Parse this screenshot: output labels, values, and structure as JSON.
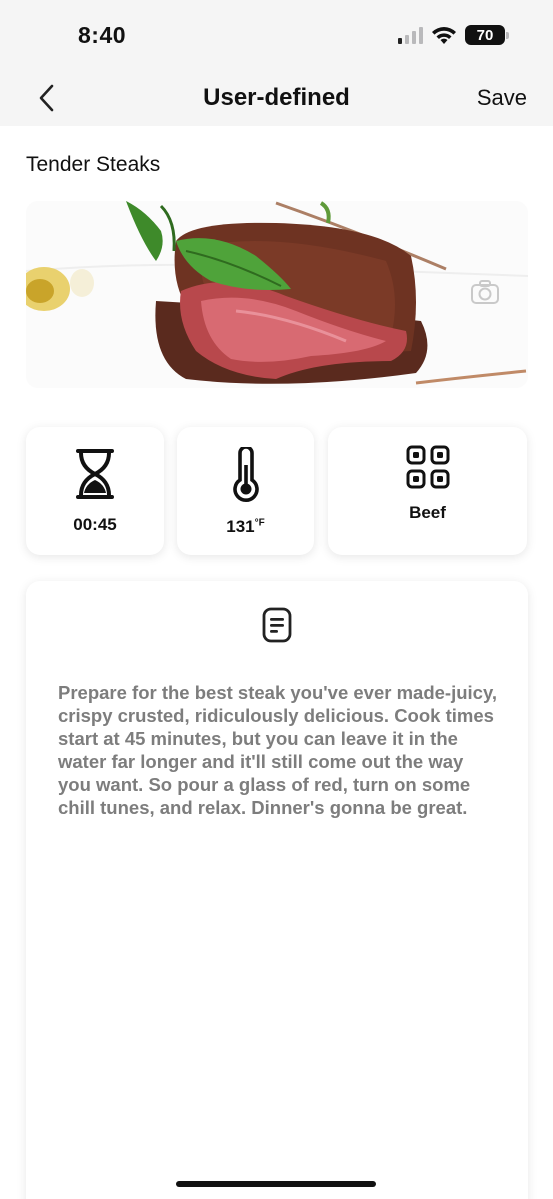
{
  "status": {
    "time": "8:40",
    "battery": "70"
  },
  "nav": {
    "title": "User-defined",
    "save_label": "Save"
  },
  "recipe": {
    "name": "Tender Steaks"
  },
  "info": {
    "time": "00:45",
    "temperature": "131",
    "temp_unit": "°F",
    "category": "Beef"
  },
  "description": "Prepare for the best steak you've ever made-juicy, crispy crusted, ridiculously delicious. Cook times start at 45 minutes, but you can leave it in the water far longer and it'll still come out the way you want. So pour a glass of red, turn on some chill tunes, and relax. Dinner's gonna be great.",
  "icons": {
    "back": "chevron-left-icon",
    "time": "hourglass-icon",
    "temperature": "thermometer-icon",
    "category": "grid-icon",
    "description": "document-icon",
    "camera": "camera-icon"
  },
  "colors": {
    "description_text": "#7d7d7d",
    "nav_bg": "#f5f5f5"
  }
}
